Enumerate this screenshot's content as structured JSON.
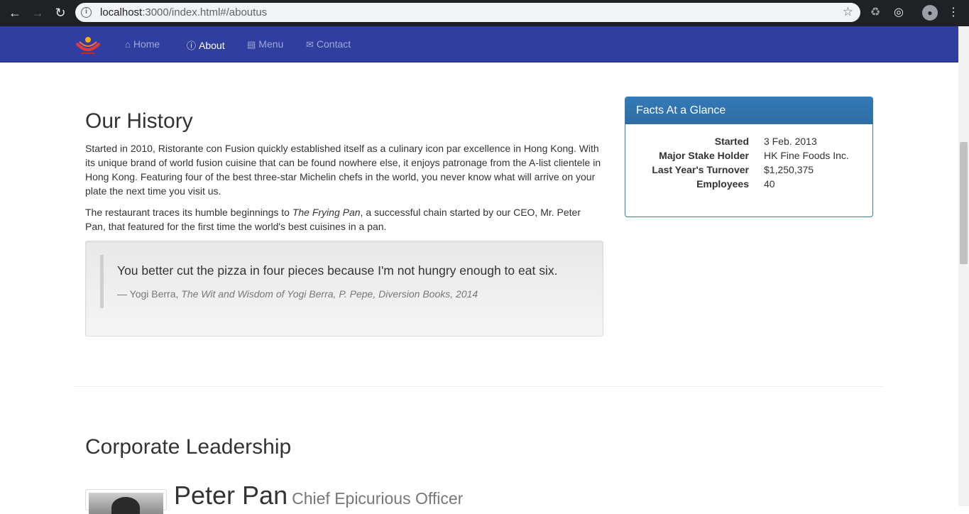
{
  "browser": {
    "url_host": "localhost",
    "url_rest": ":3000/index.html#/aboutus"
  },
  "navbar": {
    "items": [
      {
        "label": "Home",
        "icon": "home-icon",
        "active": false
      },
      {
        "label": "About",
        "icon": "info-icon",
        "active": true
      },
      {
        "label": "Menu",
        "icon": "list-icon",
        "active": false
      },
      {
        "label": "Contact",
        "icon": "envelope-icon",
        "active": false
      }
    ]
  },
  "history": {
    "heading": "Our History",
    "para1": "Started in 2010, Ristorante con Fusion quickly established itself as a culinary icon par excellence in Hong Kong. With its unique brand of world fusion cuisine that can be found nowhere else, it enjoys patronage from the A-list clientele in Hong Kong. Featuring four of the best three-star Michelin chefs in the world, you never know what will arrive on your plate the next time you visit us.",
    "para2_before": "The restaurant traces its humble beginnings to ",
    "para2_em": "The Frying Pan",
    "para2_after": ", a successful chain started by our CEO, Mr. Peter Pan, that featured for the first time the world's best cuisines in a pan."
  },
  "quote": {
    "text": "You better cut the pizza in four pieces because I'm not hungry enough to eat six.",
    "author": "— Yogi Berra, ",
    "source": "The Wit and Wisdom of Yogi Berra, P. Pepe, Diversion Books, 2014"
  },
  "facts": {
    "title": "Facts At a Glance",
    "rows": [
      {
        "key": "Started",
        "value": "3 Feb. 2013"
      },
      {
        "key": "Major Stake Holder",
        "value": "HK Fine Foods Inc."
      },
      {
        "key": "Last Year's Turnover",
        "value": "$1,250,375"
      },
      {
        "key": "Employees",
        "value": "40"
      }
    ]
  },
  "leadership": {
    "heading": "Corporate Leadership",
    "leader_name": "Peter Pan",
    "leader_title": "Chief Epicurious Officer"
  }
}
